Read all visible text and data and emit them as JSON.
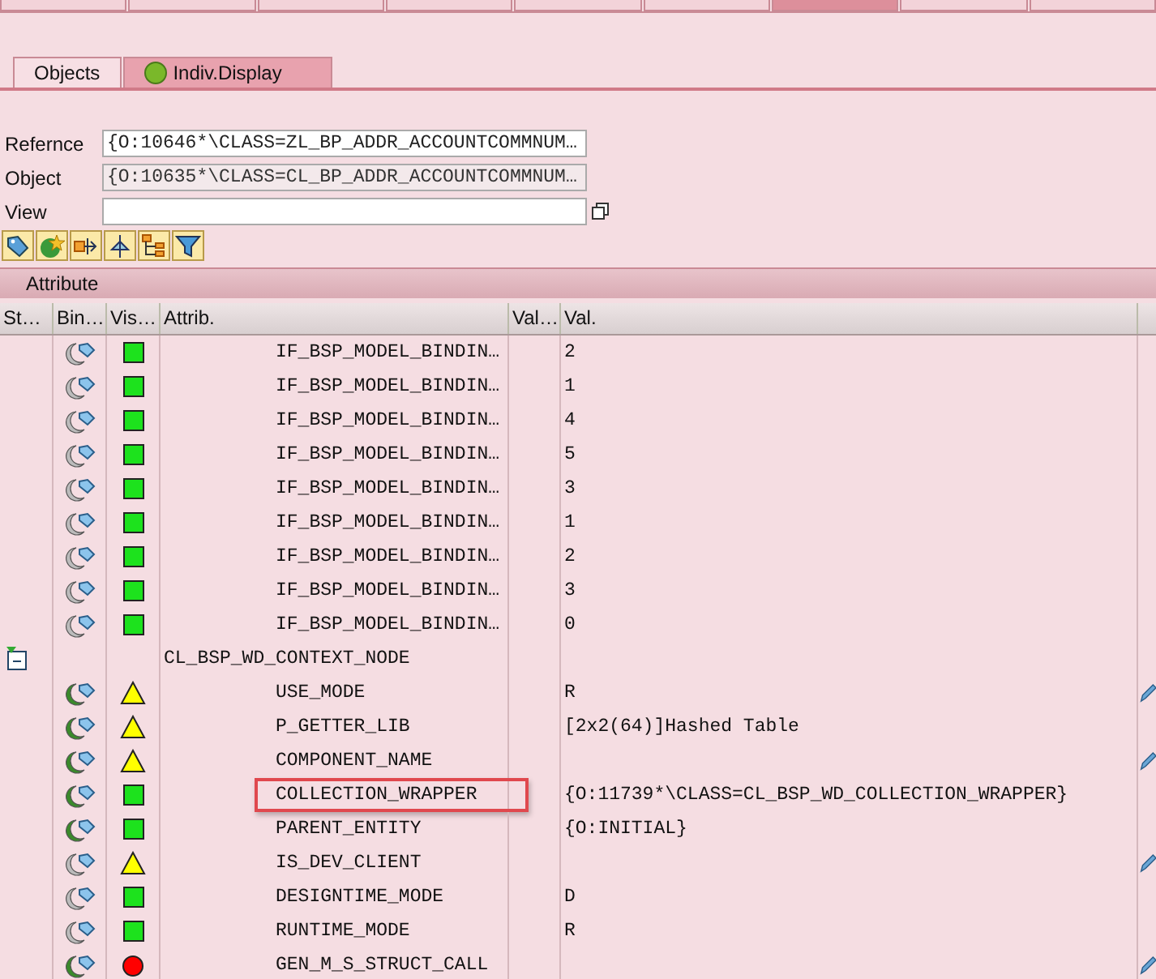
{
  "top_tabs": [
    {
      "selected": false
    },
    {
      "selected": false
    },
    {
      "selected": false
    },
    {
      "selected": false
    },
    {
      "selected": false
    },
    {
      "selected": false
    },
    {
      "selected": true
    },
    {
      "selected": false
    },
    {
      "selected": false
    }
  ],
  "sub_tabs": [
    {
      "label": "Objects",
      "selected": false,
      "status_icon": false
    },
    {
      "label": "Indiv.Display",
      "selected": true,
      "status_icon": true
    }
  ],
  "fields": [
    {
      "label": "Refernce",
      "value": "{O:10646*\\CLASS=ZL_BP_ADDR_ACCOUNTCOMMNUM…",
      "disabled": false
    },
    {
      "label": "Object",
      "value": "{O:10635*\\CLASS=CL_BP_ADDR_ACCOUNTCOMMNUM…",
      "disabled": true
    },
    {
      "label": "View",
      "disabled": false
    }
  ],
  "section_title": "Attribute",
  "table": {
    "columns": [
      "St…",
      "Bin…",
      "Vis…",
      "Attrib.",
      "Val…",
      "Val."
    ],
    "rows": [
      {
        "kind": "attribute",
        "name": "IF_BSP_MODEL_BINDIN…",
        "value": "2",
        "bound": false,
        "visibility": {
          "kind": "public"
        },
        "editable": false,
        "highlighted": false
      },
      {
        "kind": "attribute",
        "name": "IF_BSP_MODEL_BINDIN…",
        "value": "1",
        "bound": false,
        "visibility": {
          "kind": "public"
        },
        "editable": false,
        "highlighted": false
      },
      {
        "kind": "attribute",
        "name": "IF_BSP_MODEL_BINDIN…",
        "value": "4",
        "bound": false,
        "visibility": {
          "kind": "public"
        },
        "editable": false,
        "highlighted": false
      },
      {
        "kind": "attribute",
        "name": "IF_BSP_MODEL_BINDIN…",
        "value": "5",
        "bound": false,
        "visibility": {
          "kind": "public"
        },
        "editable": false,
        "highlighted": false
      },
      {
        "kind": "attribute",
        "name": "IF_BSP_MODEL_BINDIN…",
        "value": "3",
        "bound": false,
        "visibility": {
          "kind": "public"
        },
        "editable": false,
        "highlighted": false
      },
      {
        "kind": "attribute",
        "name": "IF_BSP_MODEL_BINDIN…",
        "value": "1",
        "bound": false,
        "visibility": {
          "kind": "public"
        },
        "editable": false,
        "highlighted": false
      },
      {
        "kind": "attribute",
        "name": "IF_BSP_MODEL_BINDIN…",
        "value": "2",
        "bound": false,
        "visibility": {
          "kind": "public"
        },
        "editable": false,
        "highlighted": false
      },
      {
        "kind": "attribute",
        "name": "IF_BSP_MODEL_BINDIN…",
        "value": "3",
        "bound": false,
        "visibility": {
          "kind": "public"
        },
        "editable": false,
        "highlighted": false
      },
      {
        "kind": "attribute",
        "name": "IF_BSP_MODEL_BINDIN…",
        "value": "0",
        "bound": false,
        "visibility": {
          "kind": "public"
        },
        "editable": false,
        "highlighted": false
      },
      {
        "kind": "class",
        "name": "CL_BSP_WD_CONTEXT_NODE",
        "expanded": true,
        "children": [
          {
            "kind": "attribute",
            "name": "USE_MODE",
            "value": "R",
            "bound": true,
            "visibility": {
              "kind": "protected"
            },
            "editable": true,
            "highlighted": false
          },
          {
            "kind": "attribute",
            "name": "P_GETTER_LIB",
            "value": "[2x2(64)]Hashed Table",
            "bound": true,
            "visibility": {
              "kind": "protected"
            },
            "editable": false,
            "highlighted": false
          },
          {
            "kind": "attribute",
            "name": "COMPONENT_NAME",
            "bound": true,
            "visibility": {
              "kind": "protected"
            },
            "editable": true,
            "highlighted": false
          },
          {
            "kind": "attribute",
            "name": "COLLECTION_WRAPPER",
            "value": "{O:11739*\\CLASS=CL_BSP_WD_COLLECTION_WRAPPER}",
            "bound": true,
            "visibility": {
              "kind": "public"
            },
            "editable": false,
            "highlighted": true
          },
          {
            "kind": "attribute",
            "name": "PARENT_ENTITY",
            "value": "{O:INITIAL}",
            "bound": true,
            "visibility": {
              "kind": "public"
            },
            "editable": false,
            "highlighted": false
          },
          {
            "kind": "attribute",
            "name": "IS_DEV_CLIENT",
            "bound": false,
            "visibility": {
              "kind": "protected"
            },
            "editable": true,
            "highlighted": false
          },
          {
            "kind": "attribute",
            "name": "DESIGNTIME_MODE",
            "value": "D",
            "bound": false,
            "visibility": {
              "kind": "public"
            },
            "editable": false,
            "highlighted": false
          },
          {
            "kind": "attribute",
            "name": "RUNTIME_MODE",
            "value": "R",
            "bound": false,
            "visibility": {
              "kind": "public"
            },
            "editable": false,
            "highlighted": false
          },
          {
            "kind": "attribute",
            "name": "GEN_M_S_STRUCT_CALL",
            "bound": true,
            "visibility": {
              "kind": "private"
            },
            "editable": true,
            "highlighted": false
          }
        ]
      }
    ]
  }
}
